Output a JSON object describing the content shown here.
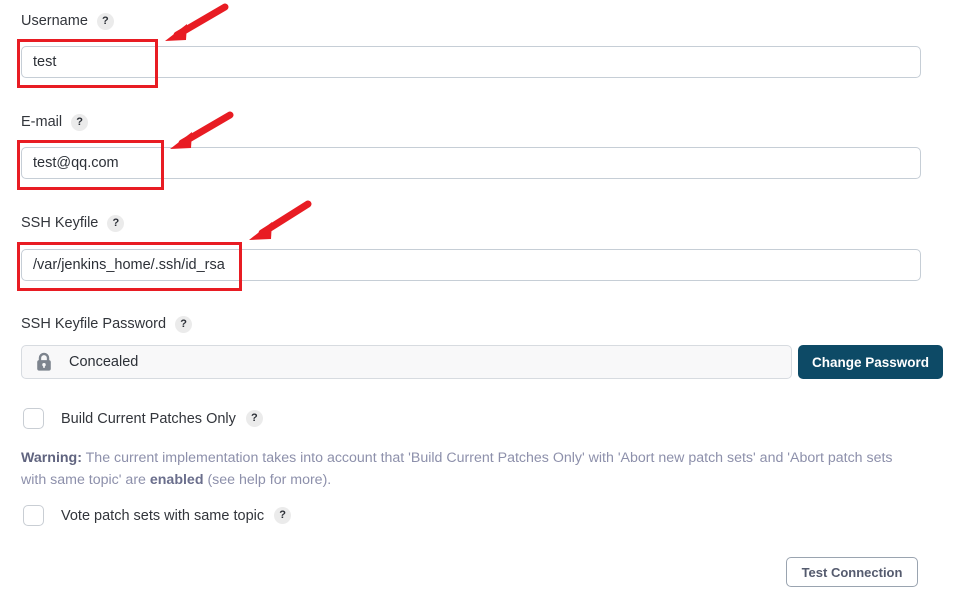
{
  "form": {
    "fields": [
      {
        "label": "Username",
        "help_icon": "help-icon",
        "value": "test",
        "placeholder": ""
      },
      {
        "label": "E-mail",
        "help_icon": "help-icon",
        "value": "test@qq.com",
        "placeholder": ""
      },
      {
        "label": "SSH Keyfile",
        "help_icon": "help-icon",
        "value": "/var/jenkins_home/.ssh/id_rsa",
        "placeholder": ""
      }
    ],
    "password_field": {
      "label": "SSH Keyfile Password",
      "help_icon": "help-icon",
      "lock_icon": "lock-icon",
      "value": "Concealed",
      "change_button": "Change Password"
    },
    "checkboxes": [
      {
        "label": "Build Current Patches Only",
        "help_icon": "help-icon",
        "checked": false
      },
      {
        "label": "Vote patch sets with same topic",
        "help_icon": "help-icon",
        "checked": false
      }
    ],
    "warning": {
      "head": "Warning:",
      "part1": " The current implementation takes into account that 'Build Current Patches Only' with 'Abort new patch sets' and 'Abort patch sets with same topic' are ",
      "emphasis": "enabled",
      "part2": " (see help for more)."
    },
    "test_connection_button": "Test Connection"
  },
  "annotations": {
    "highlight_color": "#e81c23",
    "arrow_color": "#e81c23",
    "boxes": [
      {
        "target": "username-input"
      },
      {
        "target": "email-input"
      },
      {
        "target": "ssh-keyfile-input"
      }
    ],
    "arrows": [
      {
        "points_to": "username-input"
      },
      {
        "points_to": "email-input"
      },
      {
        "points_to": "ssh-keyfile-input"
      }
    ]
  },
  "help_glyph": "?"
}
